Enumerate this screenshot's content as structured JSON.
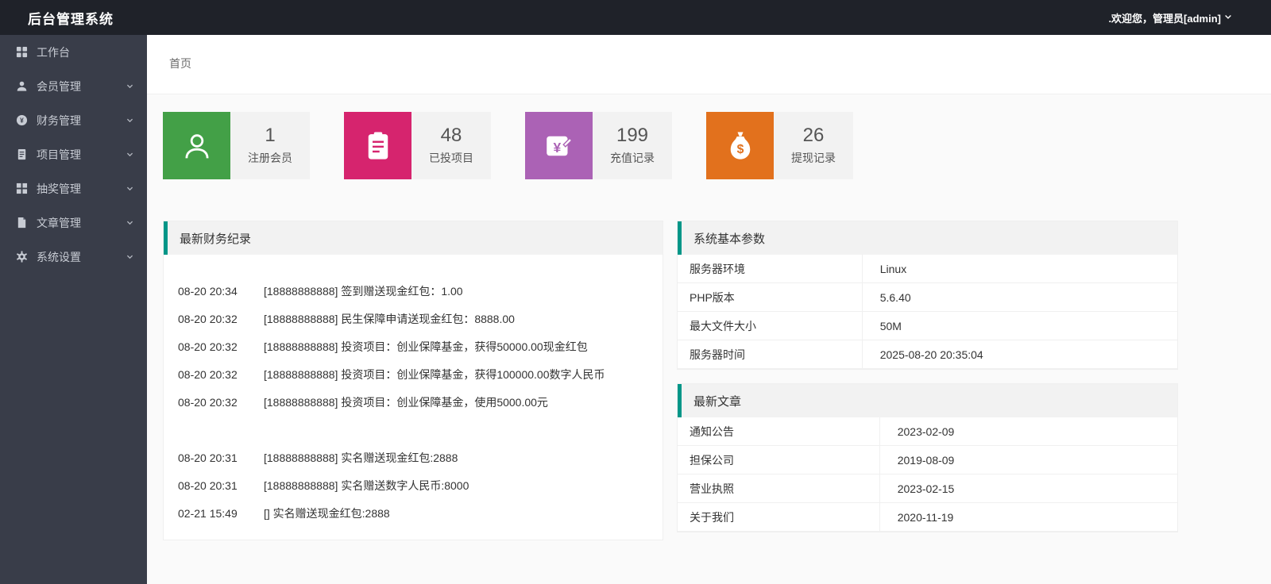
{
  "theme": {
    "accent": "#009688",
    "topbar_bg": "#1f2229",
    "sidebar_bg": "#393D49"
  },
  "topbar": {
    "title": "后台管理系统",
    "welcome": ".欢迎您，管理员[admin]"
  },
  "sidebar": {
    "items": [
      {
        "label": "工作台",
        "icon": "grid-icon",
        "expandable": false
      },
      {
        "label": "会员管理",
        "icon": "user-icon",
        "expandable": true
      },
      {
        "label": "财务管理",
        "icon": "yuan-icon",
        "expandable": true
      },
      {
        "label": "项目管理",
        "icon": "document-icon",
        "expandable": true
      },
      {
        "label": "抽奖管理",
        "icon": "grid-icon",
        "expandable": true
      },
      {
        "label": "文章管理",
        "icon": "file-icon",
        "expandable": true
      },
      {
        "label": "系统设置",
        "icon": "gear-icon",
        "expandable": true
      }
    ]
  },
  "breadcrumb": {
    "home": "首页"
  },
  "stats": [
    {
      "value": "1",
      "label": "注册会员",
      "color": "#43a047",
      "icon": "user-icon"
    },
    {
      "value": "48",
      "label": "已投项目",
      "color": "#d6246e",
      "icon": "clipboard-icon"
    },
    {
      "value": "199",
      "label": "充值记录",
      "color": "#ab62b5",
      "icon": "yuan-card-icon"
    },
    {
      "value": "26",
      "label": "提现记录",
      "color": "#e2711d",
      "icon": "money-bag-icon"
    }
  ],
  "finance_panel": {
    "title": "最新财务纪录",
    "records": [
      {
        "time": "08-20 20:34",
        "text": "[18888888888] 签到赠送现金红包：1.00"
      },
      {
        "time": "08-20 20:32",
        "text": "[18888888888] 民生保障申请送现金红包：8888.00"
      },
      {
        "time": "08-20 20:32",
        "text": "[18888888888] 投资项目：创业保障基金，获得50000.00现金红包"
      },
      {
        "time": "08-20 20:32",
        "text": "[18888888888] 投资项目：创业保障基金，获得100000.00数字人民币"
      },
      {
        "time": "08-20 20:32",
        "text": "[18888888888] 投资项目：创业保障基金，使用5000.00元"
      },
      {
        "time": "",
        "text": ""
      },
      {
        "time": "08-20 20:31",
        "text": "[18888888888] 实名赠送现金红包:2888"
      },
      {
        "time": "08-20 20:31",
        "text": "[18888888888] 实名赠送数字人民币:8000"
      },
      {
        "time": "02-21 15:49",
        "text": "[] 实名赠送现金红包:2888"
      }
    ]
  },
  "system_panel": {
    "title": "系统基本参数",
    "rows": [
      {
        "name": "服务器环境",
        "value": "Linux"
      },
      {
        "name": "PHP版本",
        "value": "5.6.40"
      },
      {
        "name": "最大文件大小",
        "value": "50M"
      },
      {
        "name": "服务器时间",
        "value": "2025-08-20 20:35:04"
      }
    ]
  },
  "articles_panel": {
    "title": "最新文章",
    "rows": [
      {
        "name": "通知公告",
        "value": "2023-02-09"
      },
      {
        "name": "担保公司",
        "value": "2019-08-09"
      },
      {
        "name": "营业执照",
        "value": "2023-02-15"
      },
      {
        "name": "关于我们",
        "value": "2020-11-19"
      }
    ]
  }
}
